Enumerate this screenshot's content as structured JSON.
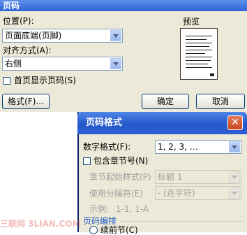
{
  "dialog_page_number": {
    "title": "页码",
    "position_label": "位置(P):",
    "position_value": "页面底端(页脚)",
    "alignment_label": "对齐方式(A):",
    "alignment_value": "右侧",
    "first_page_checkbox_label": "首页显示页码(S)",
    "first_page_checked": false,
    "preview_label": "预览",
    "format_button": "格式(F)...",
    "ok_button": "确定",
    "cancel_button": "取消"
  },
  "dialog_page_number_format": {
    "title": "页码格式",
    "number_format_label": "数字格式(F):",
    "number_format_value": "1, 2, 3, …",
    "include_chapter_label": "包含章节号(N)",
    "include_chapter_checked": false,
    "chapter_style_label": "章节起始样式(P)",
    "chapter_style_value": "标题 1",
    "separator_label": "使用分隔符(E)",
    "separator_value": "-  (连字符)",
    "example_label": "示例:",
    "example_value": "1-1, 1-A",
    "numbering_section_label": "页码编排",
    "continue_radio_label": "续前节(C)"
  },
  "watermark_text": "三联网 3LIAN.COM"
}
